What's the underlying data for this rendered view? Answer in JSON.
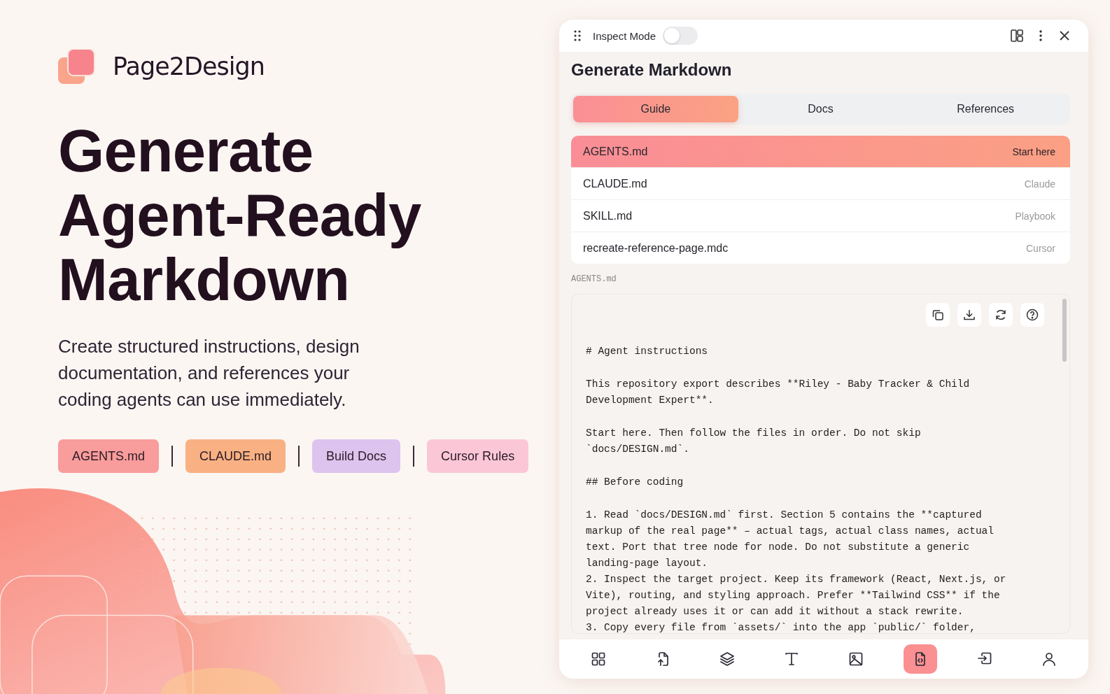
{
  "brand": {
    "name": "Page2Design"
  },
  "hero": {
    "title_lines": [
      "Generate",
      "Agent-Ready",
      "Markdown"
    ],
    "subtitle": "Create structured instructions, design documentation, and references your coding agents can use immediately.",
    "chips": [
      {
        "label": "AGENTS.md",
        "color": "#f99c9c"
      },
      {
        "label": "CLAUDE.md",
        "color": "#f9b183"
      },
      {
        "label": "Build Docs",
        "color": "#dcc4ee"
      },
      {
        "label": "Cursor Rules",
        "color": "#fbc7d7"
      }
    ]
  },
  "panel": {
    "inspect_mode": {
      "label": "Inspect Mode",
      "on": false
    },
    "title": "Generate Markdown",
    "tabs": [
      {
        "label": "Guide",
        "selected": true
      },
      {
        "label": "Docs",
        "selected": false
      },
      {
        "label": "References",
        "selected": false
      }
    ],
    "files": [
      {
        "name": "AGENTS.md",
        "tag": "Start here",
        "selected": true
      },
      {
        "name": "CLAUDE.md",
        "tag": "Claude",
        "selected": false
      },
      {
        "name": "SKILL.md",
        "tag": "Playbook",
        "selected": false
      },
      {
        "name": "recreate-reference-page.mdc",
        "tag": "Cursor",
        "selected": false
      }
    ],
    "preview_label": "AGENTS.md",
    "preview_paragraphs": [
      [
        "# Agent instructions"
      ],
      [
        "This repository export describes **Riley - Baby Tracker & Child",
        "Development Expert**."
      ],
      [
        "Start here. Then follow the files in order. Do not skip",
        "`docs/DESIGN.md`."
      ],
      [
        "## Before coding"
      ],
      [
        "1. Read `docs/DESIGN.md` first. Section 5 contains the **captured",
        "markup of the real page** – actual tags, actual class names, actual",
        "text. Port that tree node for node. Do not substitute a generic",
        "landing-page layout.",
        "2. Inspect the target project. Keep its framework (React, Next.js, or",
        "Vite), routing, and styling approach. Prefer **Tailwind CSS** if the",
        "project already uses it or can add it without a stack rewrite.",
        "3. Copy every file from `assets/` into the app `public/` folder,"
      ]
    ],
    "nav": [
      {
        "kind": "grid",
        "selected": false
      },
      {
        "kind": "file-upload",
        "selected": false
      },
      {
        "kind": "layers",
        "selected": false
      },
      {
        "kind": "text",
        "selected": false
      },
      {
        "kind": "image",
        "selected": false
      },
      {
        "kind": "code-file",
        "selected": true
      },
      {
        "kind": "import",
        "selected": false
      },
      {
        "kind": "user",
        "selected": false
      }
    ]
  }
}
